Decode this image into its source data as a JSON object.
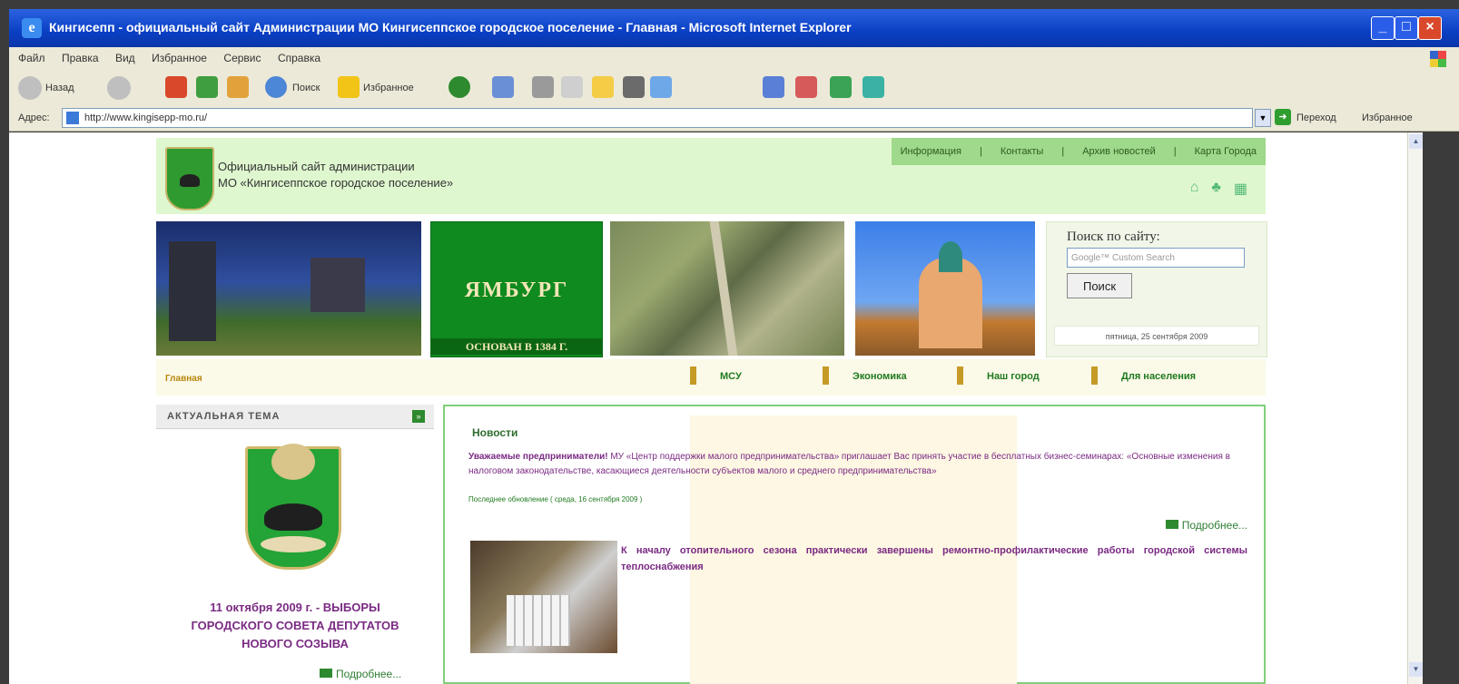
{
  "browser": {
    "title": "Кингисепп - официальный сайт Администрации МО Кингисеппское городское поселение - Главная - Microsoft Internet Explorer",
    "window_buttons": {
      "minimize": "_",
      "maximize": "□",
      "close": "×"
    },
    "menu": [
      "Файл",
      "Правка",
      "Вид",
      "Избранное",
      "Сервис",
      "Справка"
    ],
    "toolbar": {
      "back_label": "Назад",
      "search_label": "Поиск",
      "favorites_label": "Избранное"
    },
    "address": {
      "label": "Адрес:",
      "url": "http://www.kingisepp-mo.ru/",
      "go_label": "Переход",
      "links_label": "Избранное"
    }
  },
  "site": {
    "org_line1": "Официальный сайт администрации",
    "org_line2": "МО «Кингисеппское городское поселение»",
    "topnav": [
      "Информация",
      "Контакты",
      "Архив новостей",
      "Карта Города"
    ],
    "banner_text": "ЯМБУРГ",
    "banner_founded": "ОСНОВАН В 1384 Г.",
    "search": {
      "title": "Поиск по сайту:",
      "placeholder": "Google™ Custom Search",
      "button": "Поиск",
      "date": "пятница, 25 сентября 2009"
    },
    "nav": {
      "home": "Главная",
      "items": [
        "МСУ",
        "Экономика",
        "Наш город",
        "Для населения"
      ]
    },
    "left": {
      "header": "АКТУАЛЬНАЯ ТЕМА",
      "election_line1": "11 октября 2009 г. - ВЫБОРЫ",
      "election_line2": "ГОРОДСКОГО СОВЕТА ДЕПУТАТОВ",
      "election_line3": "НОВОГО СОЗЫВА",
      "more": "Подробнее..."
    },
    "main": {
      "header": "Новости",
      "news1_bold": "Уважаемые предприниматели!",
      "news1_text": " МУ «Центр поддержки малого предпринимательства» приглашает Вас принять участие в бесплатных бизнес-семинарах: «Основные изменения в налоговом законодательстве, касающиеся деятельности субъектов малого и среднего предпринимательства»",
      "news1_posted": "Последнее обновление ( среда, 16 сентября 2009 )",
      "more": "Подробнее...",
      "news2_text": "К началу отопительного сезона практически завершены ремонтно-профилактические работы городской системы теплоснабжения"
    }
  }
}
